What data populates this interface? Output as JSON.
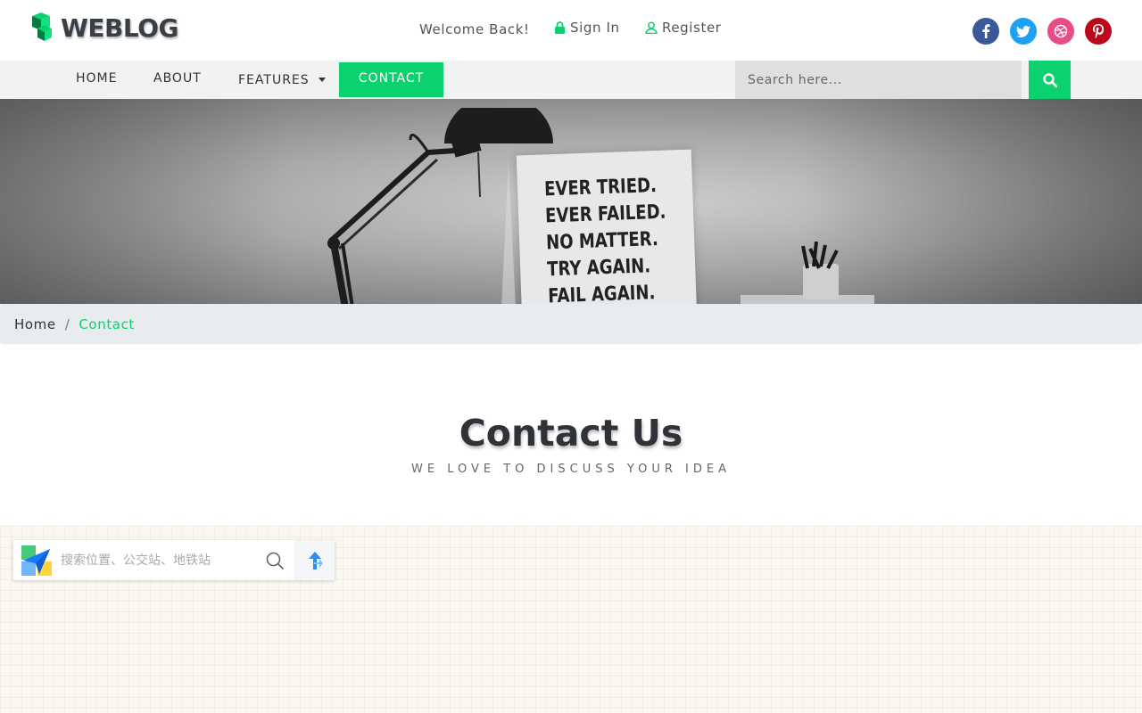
{
  "header": {
    "logo_text": "WEBLOG",
    "welcome": "Welcome Back!",
    "signin_label": "Sign In",
    "register_label": "Register",
    "accent_color": "#0bd16e",
    "socials": [
      {
        "name": "facebook",
        "glyph": "f",
        "color": "#3b5998"
      },
      {
        "name": "twitter",
        "glyph": "t",
        "color": "#1da1f2"
      },
      {
        "name": "dribbble",
        "glyph": "◎",
        "color": "#ea4c89"
      },
      {
        "name": "pinterest",
        "glyph": "p",
        "color": "#bd081c"
      }
    ]
  },
  "nav": {
    "items": [
      {
        "label": "HOME"
      },
      {
        "label": "ABOUT"
      },
      {
        "label": "FEATURES"
      },
      {
        "label": "CONTACT",
        "active": true
      }
    ],
    "search_placeholder": "Search here..."
  },
  "hero": {
    "poster_lines": [
      "EVER TRIED.",
      "EVER FAILED.",
      "NO MATTER.",
      "TRY AGAIN.",
      "FAIL AGAIN."
    ]
  },
  "breadcrumb": {
    "home": "Home",
    "separator": "/",
    "current": "Contact"
  },
  "section": {
    "title": "Contact Us",
    "subtitle": "WE LOVE TO DISCUSS YOUR IDEA"
  },
  "map": {
    "search_placeholder": "搜索位置、公交站、地铁站"
  }
}
